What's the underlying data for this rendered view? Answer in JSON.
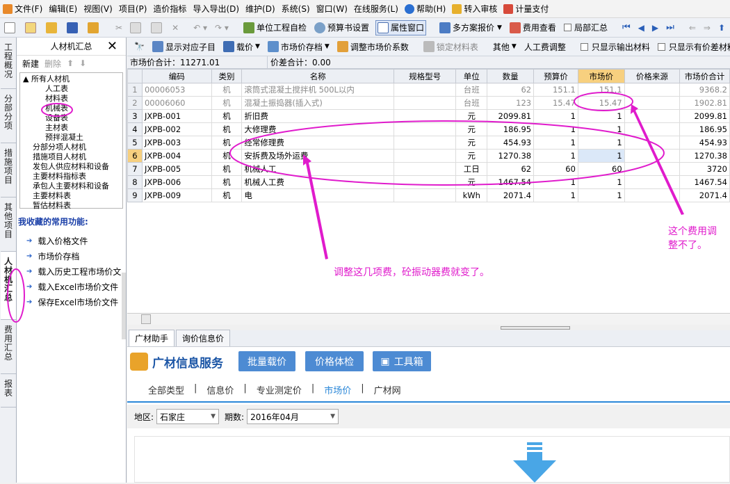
{
  "menubar": {
    "items": [
      "文件(F)",
      "编辑(E)",
      "视图(V)",
      "项目(P)",
      "造价指标",
      "导入导出(D)",
      "维护(D)",
      "系统(S)",
      "窗口(W)",
      "在线服务(L)",
      "帮助(H)",
      "转入审核",
      "计量支付"
    ]
  },
  "toolbar": {
    "unit_check": "单位工程自检",
    "budget_settings": "预算书设置",
    "property_window": "属性窗口",
    "multi_plan": "多方案报价",
    "cost_view": "费用查看",
    "partial_summary": "局部汇总"
  },
  "left_tabs": [
    "工程概况",
    "分部分项",
    "措施项目",
    "其他项目",
    "人材机汇总",
    "费用汇总",
    "报表"
  ],
  "panel": {
    "title": "人材机汇总",
    "new": "新建",
    "delete": "删除",
    "tree": [
      "所有人材机",
      "人工表",
      "材料表",
      "机械表",
      "设备表",
      "主材表",
      "预拌混凝土",
      "分部分项人材机",
      "措施项目人材机",
      "发包人供应材料和设备",
      "主要材料指标表",
      "承包人主要材料和设备",
      "主要材料表",
      "暂估材料表"
    ],
    "fav_title": "我收藏的常用功能:",
    "favorites": [
      "载入价格文件",
      "市场价存档",
      "载入历史工程市场价文",
      "载入Excel市场价文件",
      "保存Excel市场价文件"
    ]
  },
  "subtoolbar": {
    "items": [
      "显示对应子目",
      "载价",
      "市场价存档",
      "调整市场价系数",
      "锁定材料表",
      "其他",
      "人工费调整",
      "只显示输出材料",
      "只显示有价差材料"
    ]
  },
  "summary": {
    "market_total": "市场价合计：11271.01",
    "diff_total": "价差合计：0.00"
  },
  "table": {
    "headers": [
      "编码",
      "类别",
      "名称",
      "规格型号",
      "单位",
      "数量",
      "预算价",
      "市场价",
      "价格来源",
      "市场价合计"
    ],
    "rows": [
      {
        "no": "1",
        "code": "00006053",
        "type": "机",
        "name": "滚筒式混凝土搅拌机 500L以内",
        "spec": "",
        "unit": "台班",
        "qty": "62",
        "budget": "151.1",
        "market": "151.1",
        "source": "",
        "total": "9368.2"
      },
      {
        "no": "2",
        "code": "00006060",
        "type": "机",
        "name": "混凝土振捣器(插入式)",
        "spec": "",
        "unit": "台班",
        "qty": "123",
        "budget": "15.47",
        "market": "15.47",
        "source": "",
        "total": "1902.81"
      },
      {
        "no": "3",
        "code": "JXPB-001",
        "type": "机",
        "name": "折旧费",
        "spec": "",
        "unit": "元",
        "qty": "2099.81",
        "budget": "1",
        "market": "1",
        "source": "",
        "total": "2099.81"
      },
      {
        "no": "4",
        "code": "JXPB-002",
        "type": "机",
        "name": "大修理费",
        "spec": "",
        "unit": "元",
        "qty": "186.95",
        "budget": "1",
        "market": "1",
        "source": "",
        "total": "186.95"
      },
      {
        "no": "5",
        "code": "JXPB-003",
        "type": "机",
        "name": "经常修理费",
        "spec": "",
        "unit": "元",
        "qty": "454.93",
        "budget": "1",
        "market": "1",
        "source": "",
        "total": "454.93"
      },
      {
        "no": "6",
        "code": "JXPB-004",
        "type": "机",
        "name": "安拆费及场外运费",
        "spec": "",
        "unit": "元",
        "qty": "1270.38",
        "budget": "1",
        "market": "1",
        "source": "",
        "total": "1270.38"
      },
      {
        "no": "7",
        "code": "JXPB-005",
        "type": "机",
        "name": "机械人工",
        "spec": "",
        "unit": "工日",
        "qty": "62",
        "budget": "60",
        "market": "60",
        "source": "",
        "total": "3720"
      },
      {
        "no": "8",
        "code": "JXPB-006",
        "type": "机",
        "name": "机械人工费",
        "spec": "",
        "unit": "元",
        "qty": "1467.54",
        "budget": "1",
        "market": "1",
        "source": "",
        "total": "1467.54"
      },
      {
        "no": "9",
        "code": "JXPB-009",
        "type": "机",
        "name": "电",
        "spec": "",
        "unit": "kWh",
        "qty": "2071.4",
        "budget": "1",
        "market": "1",
        "source": "",
        "total": "2071.4"
      }
    ]
  },
  "annotations": {
    "note1": "调整这几项费，砼振动器费就变了。",
    "note2_line1": "这个费用调",
    "note2_line2": "整不了。"
  },
  "bottom": {
    "tabs": [
      "广材助手",
      "询价信息价"
    ],
    "brand": "广材信息服务",
    "btn_batch": "批量载价",
    "btn_check": "价格体检",
    "btn_tools": "工具箱",
    "nav": [
      "全部类型",
      "信息价",
      "专业测定价",
      "市场价",
      "广材网"
    ],
    "region_label": "地区:",
    "region_value": "石家庄",
    "period_label": "期数:",
    "period_value": "2016年04月"
  },
  "colors": {
    "accent": "#2a87d8",
    "annotation": "#e01bcc",
    "selected_header": "#f7d07f"
  }
}
